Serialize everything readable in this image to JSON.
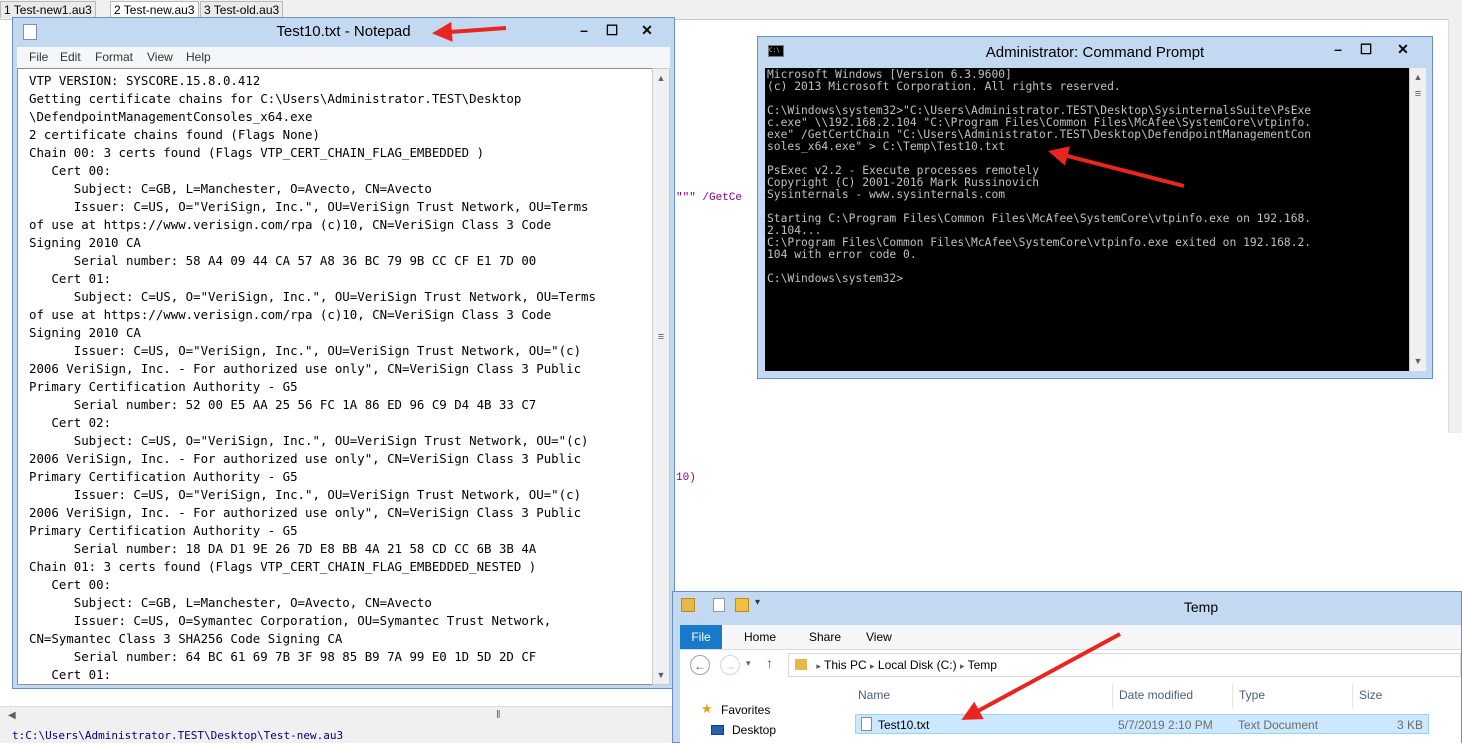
{
  "background_editor": {
    "tabs": [
      "1 Test-new1.au3",
      "2 Test-new.au3",
      "3 Test-old.au3"
    ],
    "code_fragments": [
      "\"\"\" /GetCe",
      "10)"
    ],
    "status_path": "t:C:\\Users\\Administrator.TEST\\Desktop\\Test-new.au3"
  },
  "notepad": {
    "title": "Test10.txt - Notepad",
    "window_buttons": [
      "–",
      "☐",
      "✕"
    ],
    "menu": [
      "File",
      "Edit",
      "Format",
      "View",
      "Help"
    ],
    "lines": [
      "VTP VERSION: SYSCORE.15.8.0.412",
      "Getting certificate chains for C:\\Users\\Administrator.TEST\\Desktop",
      "\\DefendpointManagementConsoles_x64.exe",
      "2 certificate chains found (Flags None)",
      "Chain 00: 3 certs found (Flags VTP_CERT_CHAIN_FLAG_EMBEDDED )",
      "   Cert 00:",
      "      Subject: C=GB, L=Manchester, O=Avecto, CN=Avecto",
      "      Issuer: C=US, O=\"VeriSign, Inc.\", OU=VeriSign Trust Network, OU=Terms",
      "of use at https://www.verisign.com/rpa (c)10, CN=VeriSign Class 3 Code",
      "Signing 2010 CA",
      "      Serial number: 58 A4 09 44 CA 57 A8 36 BC 79 9B CC CF E1 7D 00",
      "   Cert 01:",
      "      Subject: C=US, O=\"VeriSign, Inc.\", OU=VeriSign Trust Network, OU=Terms",
      "of use at https://www.verisign.com/rpa (c)10, CN=VeriSign Class 3 Code",
      "Signing 2010 CA",
      "      Issuer: C=US, O=\"VeriSign, Inc.\", OU=VeriSign Trust Network, OU=\"(c)",
      "2006 VeriSign, Inc. - For authorized use only\", CN=VeriSign Class 3 Public",
      "Primary Certification Authority - G5",
      "      Serial number: 52 00 E5 AA 25 56 FC 1A 86 ED 96 C9 D4 4B 33 C7",
      "   Cert 02:",
      "      Subject: C=US, O=\"VeriSign, Inc.\", OU=VeriSign Trust Network, OU=\"(c)",
      "2006 VeriSign, Inc. - For authorized use only\", CN=VeriSign Class 3 Public",
      "Primary Certification Authority - G5",
      "      Issuer: C=US, O=\"VeriSign, Inc.\", OU=VeriSign Trust Network, OU=\"(c)",
      "2006 VeriSign, Inc. - For authorized use only\", CN=VeriSign Class 3 Public",
      "Primary Certification Authority - G5",
      "      Serial number: 18 DA D1 9E 26 7D E8 BB 4A 21 58 CD CC 6B 3B 4A",
      "Chain 01: 3 certs found (Flags VTP_CERT_CHAIN_FLAG_EMBEDDED_NESTED )",
      "   Cert 00:",
      "      Subject: C=GB, L=Manchester, O=Avecto, CN=Avecto",
      "      Issuer: C=US, O=Symantec Corporation, OU=Symantec Trust Network,",
      "CN=Symantec Class 3 SHA256 Code Signing CA",
      "      Serial number: 64 BC 61 69 7B 3F 98 85 B9 7A 99 E0 1D 5D 2D CF",
      "   Cert 01:"
    ]
  },
  "cmd": {
    "title": "Administrator: Command Prompt",
    "icon_text": "C:\\",
    "window_buttons": [
      "–",
      "☐",
      "✕"
    ],
    "lines": [
      "Microsoft Windows [Version 6.3.9600]",
      "(c) 2013 Microsoft Corporation. All rights reserved.",
      "",
      "C:\\Windows\\system32>\"C:\\Users\\Administrator.TEST\\Desktop\\SysinternalsSuite\\PsExe",
      "c.exe\" \\\\192.168.2.104 \"C:\\Program Files\\Common Files\\McAfee\\SystemCore\\vtpinfo.",
      "exe\" /GetCertChain \"C:\\Users\\Administrator.TEST\\Desktop\\DefendpointManagementCon",
      "soles_x64.exe\" > C:\\Temp\\Test10.txt",
      "",
      "PsExec v2.2 - Execute processes remotely",
      "Copyright (C) 2001-2016 Mark Russinovich",
      "Sysinternals - www.sysinternals.com",
      "",
      "Starting C:\\Program Files\\Common Files\\McAfee\\SystemCore\\vtpinfo.exe on 192.168.",
      "2.104...",
      "C:\\Program Files\\Common Files\\McAfee\\SystemCore\\vtpinfo.exe exited on 192.168.2.",
      "104 with error code 0.",
      "",
      "C:\\Windows\\system32>"
    ]
  },
  "explorer": {
    "title": "Temp",
    "ribbon_tabs": [
      "File",
      "Home",
      "Share",
      "View"
    ],
    "breadcrumb": [
      "This PC",
      "Local Disk (C:)",
      "Temp"
    ],
    "nav": {
      "favorites": "Favorites",
      "desktop": "Desktop"
    },
    "columns": [
      "Name",
      "Date modified",
      "Type",
      "Size"
    ],
    "rows": [
      {
        "name": "Test10.txt",
        "date": "5/7/2019 2:10 PM",
        "type": "Text Document",
        "size": "3 KB"
      }
    ]
  },
  "colors": {
    "window_frame": "#c3d9f1",
    "console_bg": "#000000",
    "console_text": "#c0c0c0",
    "ribbon_file": "#1979ca",
    "selected_row": "#cce8ff",
    "annotation_arrow": "#e8261f"
  }
}
